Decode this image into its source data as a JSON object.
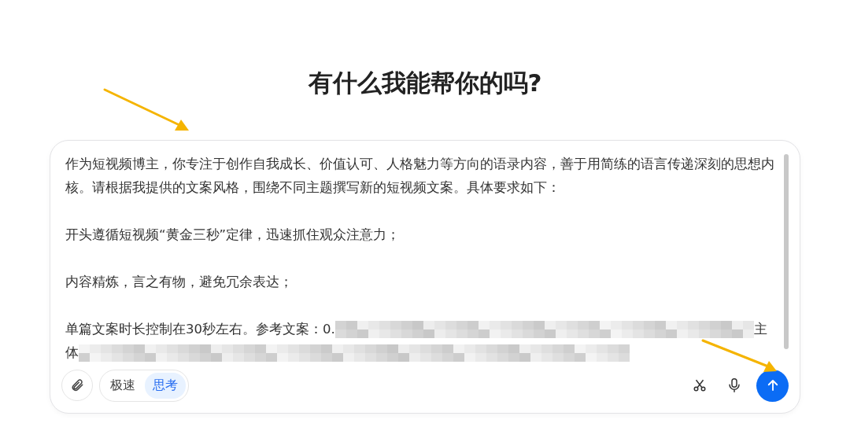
{
  "heading": "有什么我能帮你的吗?",
  "prompt": {
    "paragraphs": [
      "作为短视频博主，你专注于创作自我成长、价值认可、人格魅力等方向的语录内容，善于用简练的语言传递深刻的思想内核。请根据我提供的文案风格，围绕不同主题撰写新的短视频文案。具体要求如下：",
      "开头遵循短视频“黄金三秒”定律，迅速抓住观众注意力；",
      "内容精炼，言之有物，避免冗余表达；"
    ],
    "redacted_line_1": {
      "start": "单篇文案时长控制在30秒左右。参考文案：0.",
      "end": "主"
    },
    "redacted_line_2": {
      "start": "体"
    }
  },
  "modes": [
    {
      "label": "极速",
      "selected": false
    },
    {
      "label": "思考",
      "selected": true
    }
  ]
}
